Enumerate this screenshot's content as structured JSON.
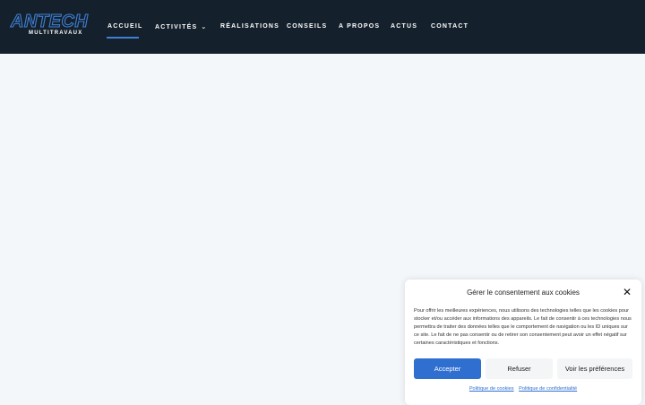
{
  "logo": {
    "main": "ANTECH",
    "sub": "MULTITRAVAUX"
  },
  "nav": {
    "items": [
      {
        "label": "ACCUEIL"
      },
      {
        "label": "ACTIVITÉS"
      },
      {
        "label": "RÉALISATIONS"
      },
      {
        "label": "CONSEILS"
      },
      {
        "label": "A PROPOS"
      },
      {
        "label": "ACTUS"
      },
      {
        "label": "CONTACT"
      }
    ],
    "active_index": 0,
    "dropdown_icon": "chevron-down-icon"
  },
  "cookie": {
    "title": "Gérer le consentement aux cookies",
    "close_icon": "close-icon",
    "text": "Pour offrir les meilleures expériences, nous utilisons des technologies telles que les cookies pour stocker et/ou accéder aux informations des appareils. Le fait de consentir à ces technologies nous permettra de traiter des données telles que le comportement de navigation ou les ID uniques sur ce site. Le fait de ne pas consentir ou de retirer son consentement peut avoir un effet négatif sur certaines caractéristiques et fonctions.",
    "accept_label": "Accepter",
    "refuse_label": "Refuser",
    "prefs_label": "Voir les préférences",
    "cookie_policy_link": "Politique de cookies",
    "privacy_policy_link": "Politique de confidentialité"
  },
  "colors": {
    "header_bg": "#14202b",
    "accent": "#3f7fd4",
    "page_bg": "#f4f7fa",
    "accept_bg": "#2f6fd0"
  }
}
